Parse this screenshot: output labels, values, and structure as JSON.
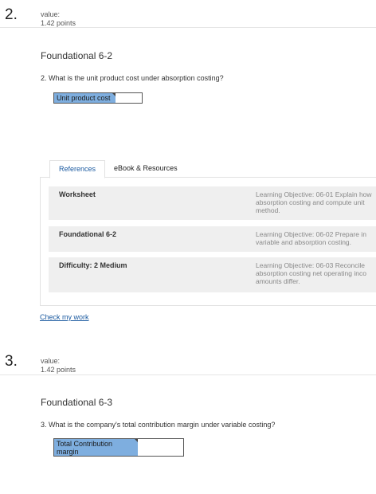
{
  "questions": [
    {
      "number": "2.",
      "value_label": "value:",
      "points": "1.42 points",
      "title": "Foundational 6-2",
      "text": "2.  What is the unit product cost under absorption costing?",
      "answer_label": "Unit product cost",
      "answer_value": ""
    },
    {
      "number": "3.",
      "value_label": "value:",
      "points": "1.42 points",
      "title": "Foundational 6-3",
      "text": "3.  What is the company's total contribution margin under variable costing?",
      "answer_label": "Total Contribution margin",
      "answer_value": ""
    }
  ],
  "tabs": [
    "References",
    "eBook & Resources"
  ],
  "references": [
    {
      "title": "Worksheet",
      "desc_lines": [
        "Learning Objective: 06-01 Explain how",
        "absorption costing and compute unit",
        "method."
      ]
    },
    {
      "title": "Foundational 6-2",
      "desc_lines": [
        "Learning Objective: 06-02 Prepare in",
        "variable and absorption costing."
      ]
    },
    {
      "title": "Difficulty: 2 Medium",
      "desc_lines": [
        "Learning Objective: 06-03 Reconcile",
        "absorption costing net operating inco",
        "amounts differ."
      ]
    }
  ],
  "check_my_work": "Check my work",
  "colors": {
    "answer_label_bg": "#7eaedf",
    "link": "#1b5aa0",
    "row_bg": "#efefef"
  }
}
